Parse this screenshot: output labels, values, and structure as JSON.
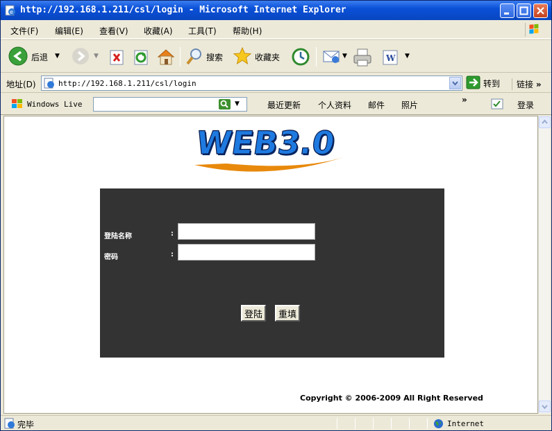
{
  "window": {
    "title": "http://192.168.1.211/csl/login - Microsoft Internet Explorer"
  },
  "menu": {
    "items": [
      "文件(F)",
      "编辑(E)",
      "查看(V)",
      "收藏(A)",
      "工具(T)",
      "帮助(H)"
    ]
  },
  "toolbar": {
    "back_label": "后退",
    "search_label": "搜索",
    "favorites_label": "收藏夹"
  },
  "address": {
    "label": "地址(D)",
    "url": "http://192.168.1.211/csl/login",
    "go_label": "转到",
    "links_label": "链接"
  },
  "live_bar": {
    "brand": "Windows Live",
    "links": [
      "最近更新",
      "个人资料",
      "邮件",
      "照片"
    ],
    "signin_label": "登录"
  },
  "page": {
    "logo_text": "WEB3.0",
    "username_label": "登陆名称",
    "password_label": "密码",
    "colon": ":",
    "username_value": "",
    "password_value": "",
    "login_button": "登陆",
    "reset_button": "重填",
    "copyright": "Copyright © 2006-2009 All Right Reserved"
  },
  "status": {
    "text": "完毕",
    "zone": "Internet"
  },
  "colors": {
    "panel_bg": "#333333",
    "titlebar": "#0a50d8",
    "logo_blue": "#1e7ae0",
    "logo_swoosh": "#e8890c"
  }
}
